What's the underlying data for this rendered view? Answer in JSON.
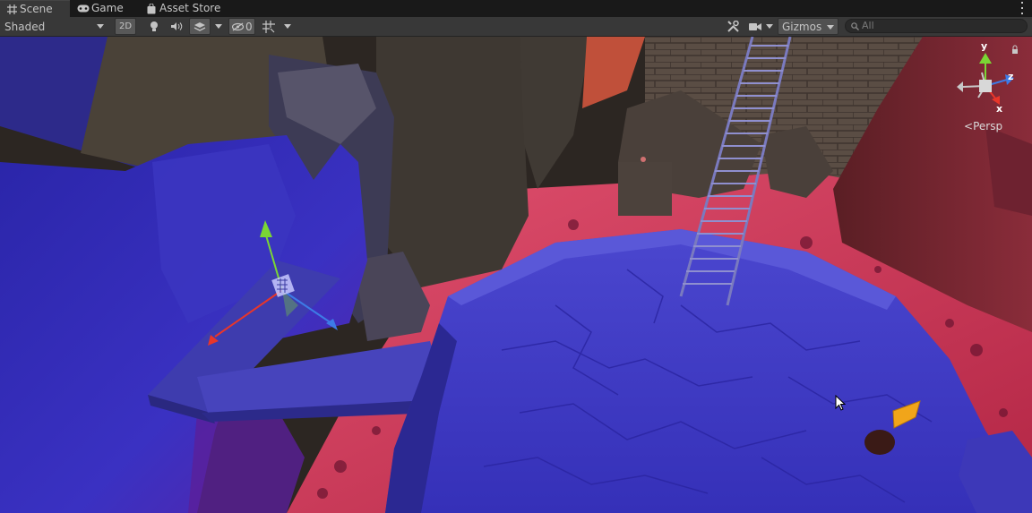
{
  "tabs": [
    {
      "label": "Scene",
      "icon": "grid-icon",
      "active": true
    },
    {
      "label": "Game",
      "icon": "gamepad-icon",
      "active": false
    },
    {
      "label": "Asset Store",
      "icon": "shopping-bag-icon",
      "active": false
    }
  ],
  "toolbar": {
    "draw_mode": "Shaded",
    "mode_2d": "2D",
    "hidden_count": "0",
    "gizmos_label": "Gizmos",
    "search_placeholder": "All"
  },
  "scene_gizmo": {
    "projection": "Persp",
    "axes": {
      "y": "y",
      "x": "x",
      "z": "z"
    },
    "colors": {
      "x": "#e8362a",
      "y": "#7ad634",
      "z": "#3d7be6"
    }
  },
  "colors": {
    "lava": "#d93a5a",
    "stone_blue": "#3a34c8",
    "toolbar_bg": "#383838",
    "tab_bg": "#191919"
  }
}
